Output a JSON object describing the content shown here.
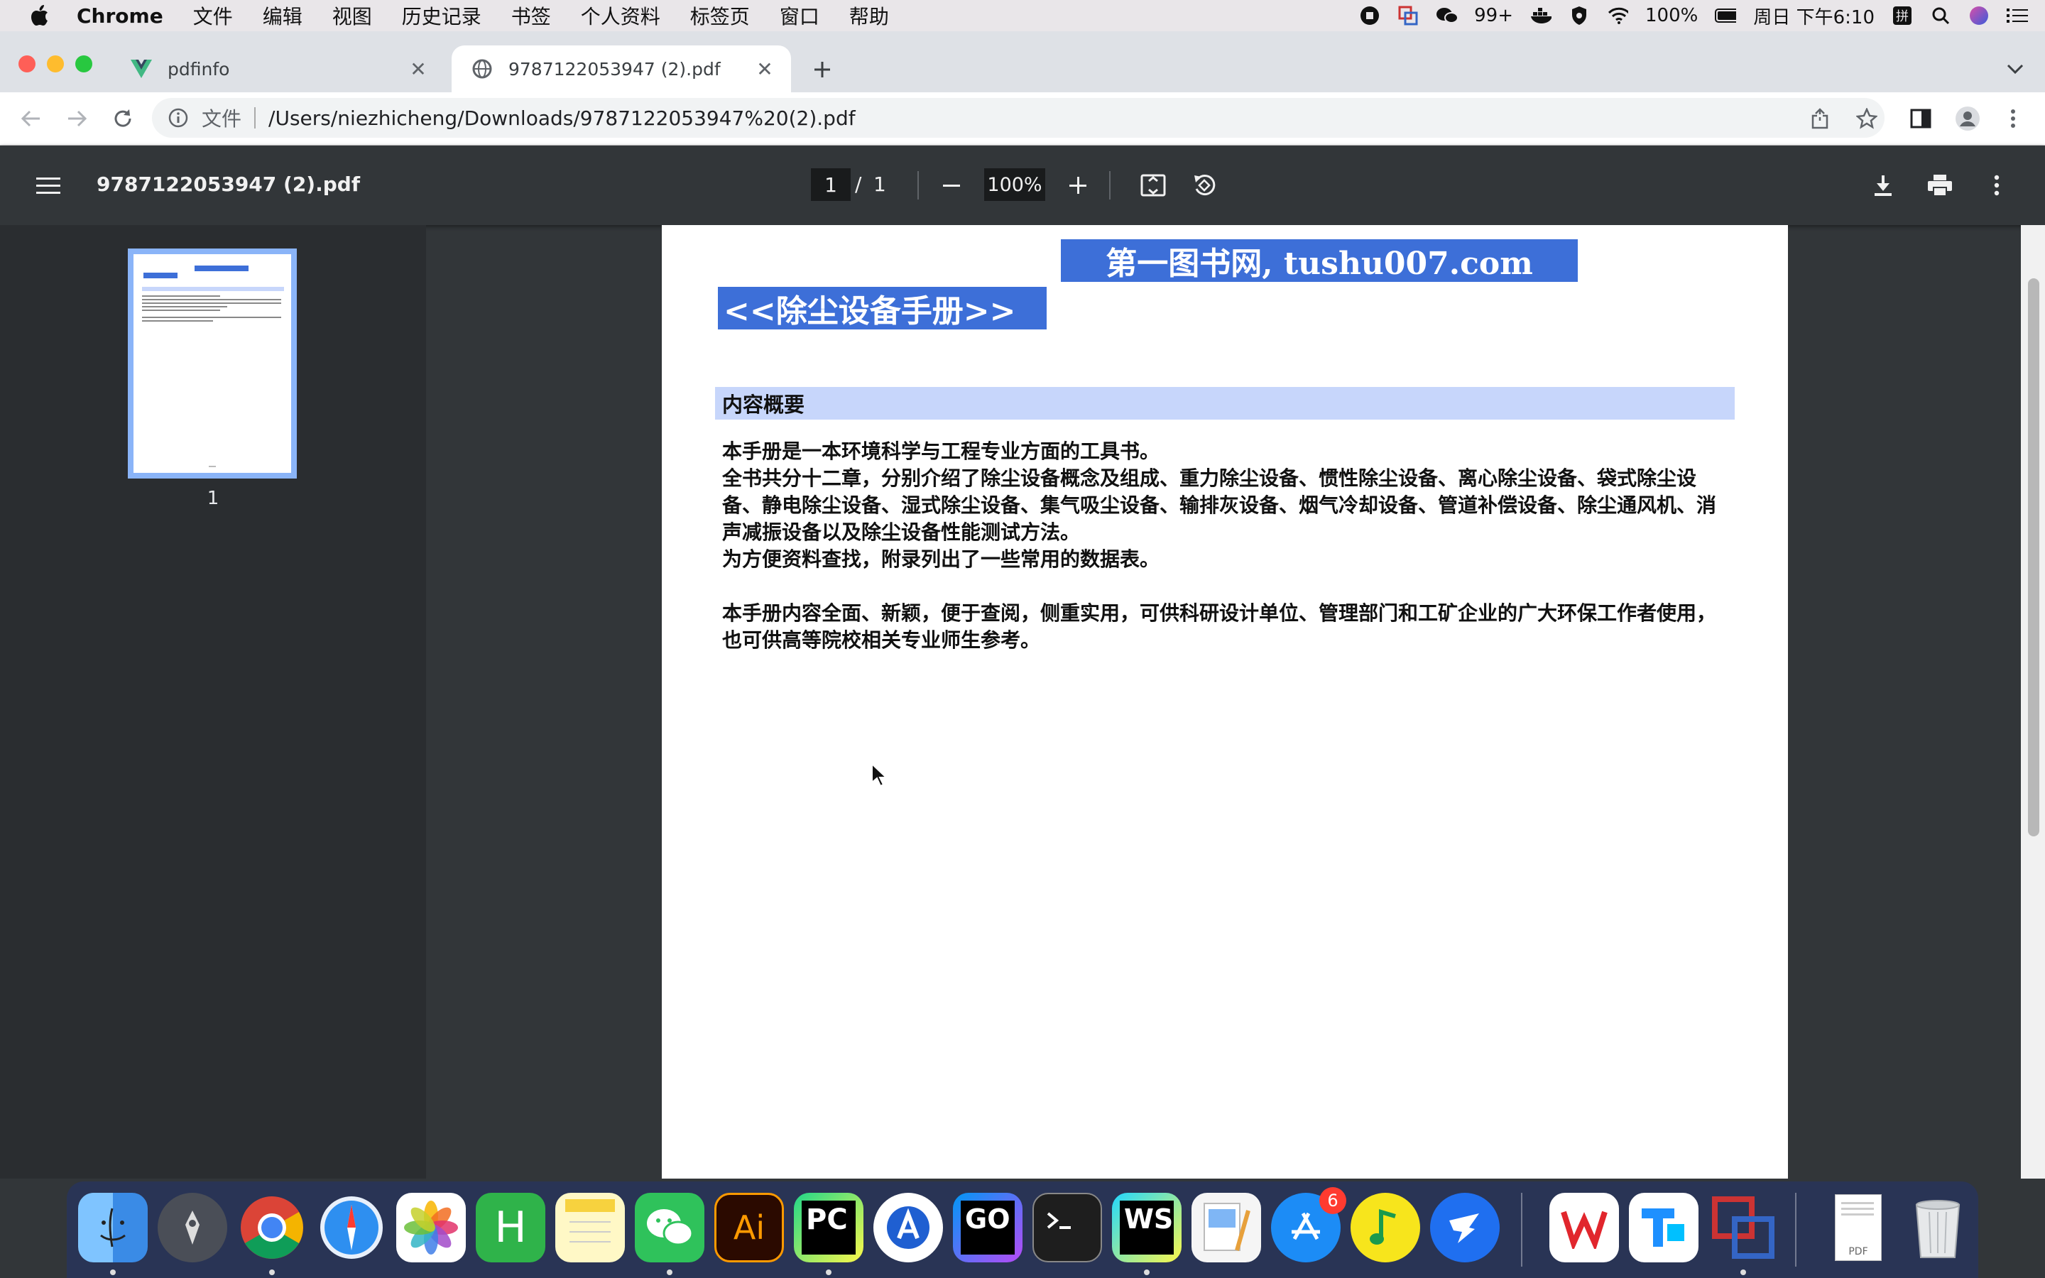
{
  "menubar": {
    "app_name": "Chrome",
    "menus": [
      "文件",
      "编辑",
      "视图",
      "历史记录",
      "书签",
      "个人资料",
      "标签页",
      "窗口",
      "帮助"
    ],
    "wechat_count": "99+",
    "battery": "100%",
    "clock": "周日 下午6:10"
  },
  "tabs": [
    {
      "title": "pdfinfo"
    },
    {
      "title": "9787122053947 (2).pdf"
    }
  ],
  "omnibox": {
    "scheme_label": "文件",
    "url": "/Users/niezhicheng/Downloads/9787122053947%20(2).pdf"
  },
  "pdf_toolbar": {
    "filename": "9787122053947 (2).pdf",
    "current_page": "1",
    "separator": "/",
    "total_pages": "1",
    "zoom": "100%"
  },
  "sidebar": {
    "thumb_label": "1"
  },
  "document": {
    "site_banner": "第一图书网, tushu007.com",
    "book_title": "<<除尘设备手册>>",
    "section_heading": "内容概要",
    "para1": "本手册是一本环境科学与工程专业方面的工具书。\n全书共分十二章，分别介绍了除尘设备概念及组成、重力除尘设备、惯性除尘设备、离心除尘设备、袋式除尘设备、静电除尘设备、湿式除尘设备、集气吸尘设备、输排灰设备、烟气冷却设备、管道补偿设备、除尘通风机、消声减振设备以及除尘设备性能测试方法。\n为方便资料查找，附录列出了一些常用的数据表。",
    "para2": "本手册内容全面、新颖，便于查阅，侧重实用，可供科研设计单位、管理部门和工矿企业的广大环保工作者使用，也可供高等院校相关专业师生参考。"
  },
  "dock": {
    "items": [
      "finder",
      "launchpad",
      "chrome",
      "safari",
      "photos",
      "hbuilder",
      "notes",
      "wechat",
      "illustrator",
      "pycharm",
      "xcode-instruments",
      "goland",
      "terminal",
      "webstorm",
      "preview",
      "app-store",
      "music",
      "dingtalk",
      "wps",
      "teams",
      "parallels",
      "pdf-file",
      "trash"
    ],
    "illustrator_label": "Ai",
    "pycharm_label": "PC",
    "goland_label": "GO",
    "webstorm_label": "WS",
    "hbuilder_label": "H",
    "appstore_badge": "6",
    "pdf_label": "PDF"
  }
}
